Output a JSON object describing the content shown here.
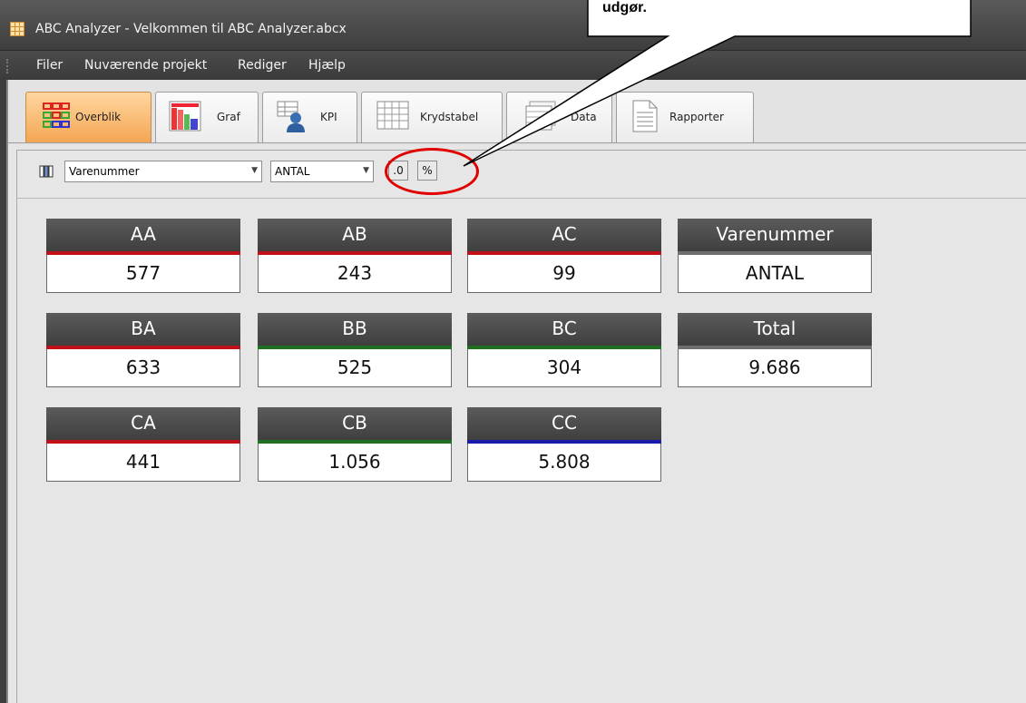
{
  "window": {
    "title": "ABC Analyzer - Velkommen til ABC Analyzer.abcx"
  },
  "menu": [
    "Filer",
    "Nuværende projekt",
    "Rediger",
    "Hjælp"
  ],
  "tabs": [
    {
      "label": "Overblik",
      "icon": "overview-grid-icon",
      "active": true
    },
    {
      "label": "Graf",
      "icon": "bar-graph-icon"
    },
    {
      "label": "KPI",
      "icon": "kpi-user-icon"
    },
    {
      "label": "Krydstabel",
      "icon": "cross-table-icon"
    },
    {
      "label": "Data",
      "icon": "data-table-icon"
    },
    {
      "label": "Rapporter",
      "icon": "report-document-icon"
    }
  ],
  "toolbar": {
    "dimension_value": "Varenummer",
    "measure_value": "ANTAL",
    "decimal_label": ".0",
    "percent_label": "%"
  },
  "callout": {
    "text": "udgør."
  },
  "cards": [
    {
      "label": "AA",
      "value": "577",
      "stripe": "#c0111a"
    },
    {
      "label": "AB",
      "value": "243",
      "stripe": "#c0111a"
    },
    {
      "label": "AC",
      "value": "99",
      "stripe": "#c0111a"
    },
    {
      "label": "Varenummer",
      "value": "ANTAL",
      "stripe": "#6f6f6f"
    },
    {
      "label": "BA",
      "value": "633",
      "stripe": "#c0111a"
    },
    {
      "label": "BB",
      "value": "525",
      "stripe": "#1e6f1e"
    },
    {
      "label": "BC",
      "value": "304",
      "stripe": "#1e6f1e"
    },
    {
      "label": "Total",
      "value": "9.686",
      "stripe": "#6f6f6f"
    },
    {
      "label": "CA",
      "value": "441",
      "stripe": "#c0111a"
    },
    {
      "label": "CB",
      "value": "1.056",
      "stripe": "#1e6f1e"
    },
    {
      "label": "CC",
      "value": "5.808",
      "stripe": "#1a1aa8"
    }
  ]
}
